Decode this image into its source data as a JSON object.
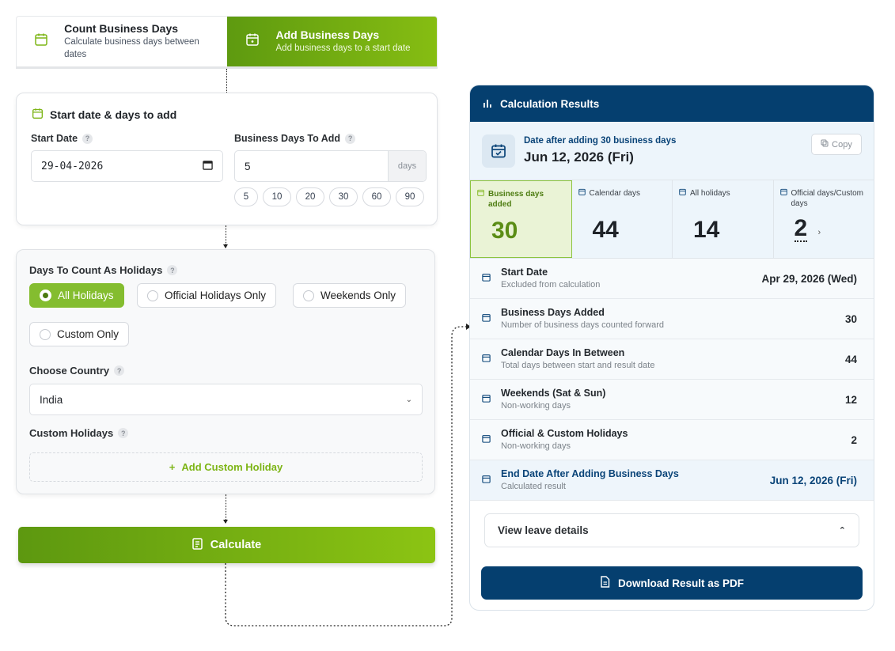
{
  "tabs": [
    {
      "title": "Count Business Days",
      "subtitle": "Calculate business days between dates"
    },
    {
      "title": "Add Business Days",
      "subtitle": "Add business days to a start date"
    }
  ],
  "form": {
    "section_title": "Start date & days to add",
    "start_date_label": "Start Date",
    "start_date_value": "29-04-2026",
    "days_label": "Business Days To Add",
    "days_value": "5",
    "days_suffix": "days",
    "quick_chips": [
      "5",
      "10",
      "20",
      "30",
      "60",
      "90"
    ]
  },
  "holidays": {
    "label": "Days To Count As Holidays",
    "options": [
      "All Holidays",
      "Official Holidays Only",
      "Weekends Only",
      "Custom Only"
    ],
    "selected": "All Holidays",
    "country_label": "Choose Country",
    "country_value": "India",
    "custom_label": "Custom Holidays",
    "add_custom": "Add Custom Holiday"
  },
  "calculate_label": "Calculate",
  "results": {
    "header": "Calculation Results",
    "top_label": "Date after adding 30 business days",
    "top_value": "Jun 12, 2026 (Fri)",
    "copy_label": "Copy",
    "stats": [
      {
        "label": "Business days added",
        "value": "30"
      },
      {
        "label": "Calendar days",
        "value": "44"
      },
      {
        "label": "All holidays",
        "value": "14"
      },
      {
        "label": "Official days/Custom days",
        "value": "2"
      }
    ],
    "rows": [
      {
        "title": "Start Date",
        "sub": "Excluded from calculation",
        "value": "Apr 29, 2026 (Wed)"
      },
      {
        "title": "Business Days Added",
        "sub": "Number of business days counted forward",
        "value": "30"
      },
      {
        "title": "Calendar Days In Between",
        "sub": "Total days between start and result date",
        "value": "44"
      },
      {
        "title": "Weekends (Sat & Sun)",
        "sub": "Non-working days",
        "value": "12"
      },
      {
        "title": "Official & Custom Holidays",
        "sub": "Non-working days",
        "value": "2"
      },
      {
        "title": "End Date After Adding Business Days",
        "sub": "Calculated result",
        "value": "Jun 12, 2026 (Fri)"
      }
    ],
    "leave_label": "View leave details",
    "download_label": "Download Result as PDF"
  },
  "colors": {
    "green": "#7db516",
    "navy": "#053f6f"
  }
}
